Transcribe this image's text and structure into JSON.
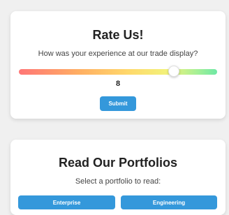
{
  "rating_card": {
    "title": "Rate Us!",
    "question": "How was your experience at our trade display?",
    "slider": {
      "min": 0,
      "max": 10,
      "value": 8,
      "gradient_colors": [
        "#ff7676",
        "#ffae63",
        "#ffd86b",
        "#f2f27a",
        "#a5f096",
        "#6ee8a5"
      ]
    },
    "value_display": "8",
    "submit_label": "Submit"
  },
  "portfolio_card": {
    "title": "Read Our Portfolios",
    "prompt": "Select a portfolio to read:",
    "buttons": [
      {
        "label": "Enterprise"
      },
      {
        "label": "Engineering"
      }
    ]
  },
  "colors": {
    "accent": "#3498db",
    "background": "#f0f0f0",
    "card": "#ffffff"
  }
}
